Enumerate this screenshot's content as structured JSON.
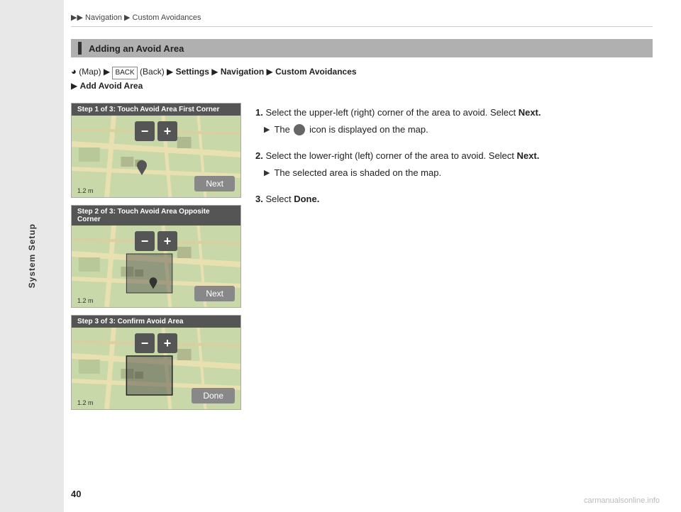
{
  "breadcrumb": {
    "text": "▶▶ Navigation ▶ Custom Avoidances"
  },
  "sidebar": {
    "label": "System Setup"
  },
  "section": {
    "title": "Adding an Avoid Area"
  },
  "nav_path": {
    "parts": [
      {
        "text": "h",
        "type": "icon"
      },
      {
        "text": "(Map)",
        "type": "normal"
      },
      {
        "text": "▶",
        "type": "arrow"
      },
      {
        "text": "(Back)",
        "type": "normal"
      },
      {
        "text": "▶",
        "type": "arrow"
      },
      {
        "text": "Settings",
        "type": "bold"
      },
      {
        "text": "▶",
        "type": "arrow"
      },
      {
        "text": "Navigation",
        "type": "bold"
      },
      {
        "text": "▶",
        "type": "arrow"
      },
      {
        "text": "Custom Avoidances",
        "type": "bold"
      },
      {
        "text": "▶",
        "type": "arrow"
      },
      {
        "text": "Add Avoid Area",
        "type": "bold"
      }
    ]
  },
  "maps": [
    {
      "header": "Step 1 of 3: Touch Avoid Area First Corner",
      "footer_btn": "Next",
      "scale": "1.2 m"
    },
    {
      "header": "Step 2 of 3: Touch Avoid Area Opposite Corner",
      "footer_btn": "Next",
      "scale": "1.2 m"
    },
    {
      "header": "Step 3 of 3: Confirm Avoid Area",
      "footer_btn": "Done",
      "scale": "1.2 m"
    }
  ],
  "controls": {
    "minus": "−",
    "plus": "+"
  },
  "steps": [
    {
      "num": "1.",
      "text": "Select the upper-left (right) corner of the area to avoid. Select",
      "bold": "Next.",
      "sub": "The",
      "sub_bold": "",
      "sub_end": "icon is displayed on the map."
    },
    {
      "num": "2.",
      "text": "Select the lower-right (left) corner of the area to avoid. Select",
      "bold": "Next.",
      "sub": "The selected area is shaded on the map.",
      "sub_bold": "",
      "sub_end": ""
    },
    {
      "num": "3.",
      "text": "Select",
      "bold": "Done.",
      "sub": "",
      "sub_bold": "",
      "sub_end": ""
    }
  ],
  "page_number": "40",
  "watermark": "carmanualsonline.info"
}
